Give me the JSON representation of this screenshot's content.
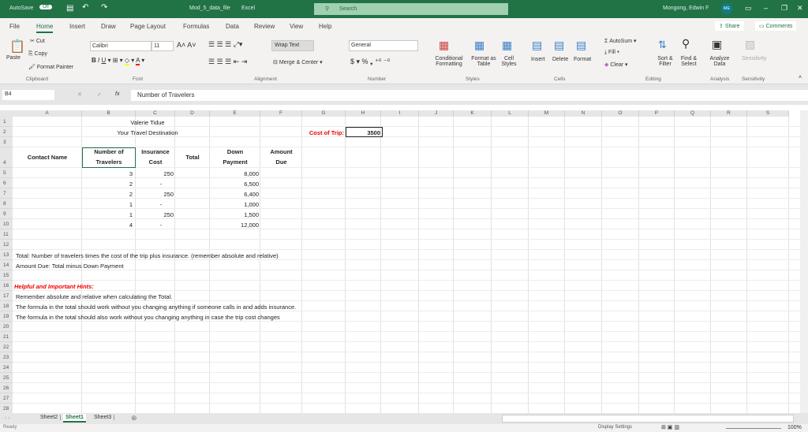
{
  "title_bar": {
    "autosave": "AutoSave",
    "autosave_state": "Off",
    "filename": "Mod_5_data_file",
    "app": "Excel",
    "search_placeholder": "Search",
    "user": "Mongong, Edwin F",
    "initials": "ME",
    "accent": "#217346"
  },
  "tabs": [
    "File",
    "Home",
    "Insert",
    "Draw",
    "Page Layout",
    "Formulas",
    "Data",
    "Review",
    "View",
    "Help"
  ],
  "active_tab": "Home",
  "share": "Share",
  "comments": "Comments",
  "ribbon": {
    "clipboard": {
      "paste": "Paste",
      "cut": "Cut",
      "copy": "Copy",
      "format_painter": "Format Painter",
      "group": "Clipboard"
    },
    "font": {
      "name": "Calibri",
      "size": "11",
      "group": "Font"
    },
    "alignment": {
      "wrap": "Wrap Text",
      "merge": "Merge & Center",
      "group": "Alignment"
    },
    "number": {
      "format": "General",
      "group": "Number"
    },
    "styles": {
      "conditional": "Conditional Formatting",
      "format_table": "Format as Table",
      "cell_styles": "Cell Styles",
      "group": "Styles"
    },
    "cells": {
      "insert": "Insert",
      "delete": "Delete",
      "format": "Format",
      "group": "Cells"
    },
    "editing": {
      "autosum": "AutoSum",
      "fill": "Fill",
      "clear": "Clear",
      "sort": "Sort & Filter",
      "find": "Find & Select",
      "group": "Editing"
    },
    "analysis": {
      "analyze": "Analyze Data",
      "group": "Analysis"
    },
    "sensitivity": {
      "label": "Sensitivity",
      "group": "Sensitivity"
    }
  },
  "formula_bar": {
    "name_box": "B4",
    "formula": "Number of Travelers"
  },
  "columns": [
    "A",
    "B",
    "C",
    "D",
    "E",
    "F",
    "G",
    "H",
    "I",
    "J",
    "K",
    "L",
    "M",
    "N",
    "O",
    "P",
    "Q",
    "R",
    "S"
  ],
  "sheet": {
    "name": "Valerie Tidue",
    "destination": "Your Travel Destination",
    "cost_label": "Cost of Trip:",
    "cost_value": "3500",
    "headers": {
      "contact": "Contact Name",
      "travelers1": "Number of",
      "travelers2": "Travelers",
      "ins1": "Insurance",
      "ins2": "Cost",
      "total": "Total",
      "down1": "Down",
      "down2": "Payment",
      "due1": "Amount",
      "due2": "Due"
    },
    "rows": [
      [
        "3",
        "250",
        "8,000"
      ],
      [
        "2",
        "-",
        "6,500"
      ],
      [
        "2",
        "250",
        "6,400"
      ],
      [
        "1",
        "-",
        "1,000"
      ],
      [
        "1",
        "250",
        "1,500"
      ],
      [
        "4",
        "-",
        "12,000"
      ]
    ],
    "note13": "Total:   Number of travelers times the cost of the trip plus insurance. (remember absolute and relative)",
    "note14": "Amount Due: Total minus Down Payment",
    "hints_title": "Helpful and Important Hints:",
    "hint17": "Remember absolute and relative when calculating the Total.",
    "hint18": "The formula in the total should work without you changing anything if someone calls in and adds insurance.",
    "hint19": "The formula in the total should also work without you changing anything in case the trip cost changes"
  },
  "sheet_tabs": [
    "Sheet2",
    "Sheet1",
    "Sheet3"
  ],
  "active_sheet": "Sheet1",
  "status": {
    "ready": "Ready",
    "display": "Display Settings",
    "zoom": "100%"
  }
}
